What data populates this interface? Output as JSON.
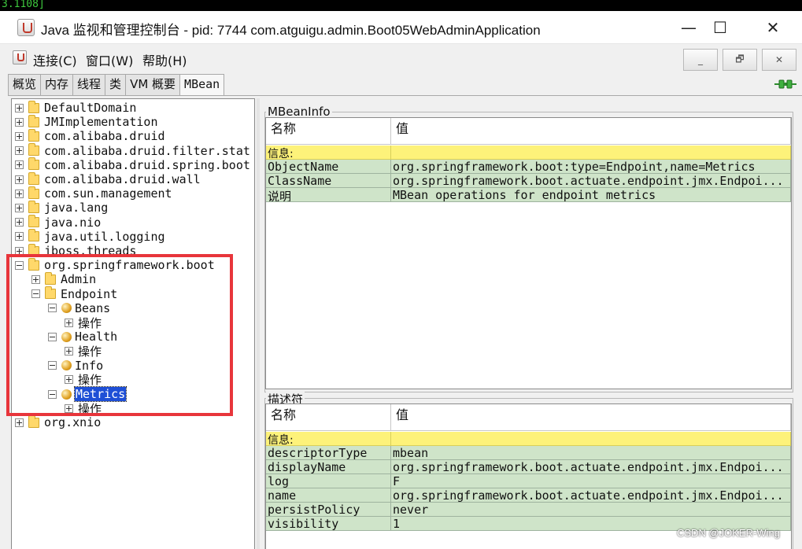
{
  "background_terminal": {
    "text": "3.1108]"
  },
  "window": {
    "title": "Java 监视和管理控制台 - pid: 7744 com.atguigu.admin.Boot05WebAdminApplication",
    "minimize_glyph": "—",
    "maximize_glyph": "☐",
    "close_glyph": "✕"
  },
  "menu": {
    "items": [
      "连接(C)",
      "窗口(W)",
      "帮助(H)"
    ],
    "mdi_minimize": "_",
    "mdi_restore": "🗗",
    "mdi_close": "✕"
  },
  "tabs": [
    "概览",
    "内存",
    "线程",
    "类",
    "VM 概要",
    "MBean"
  ],
  "active_tab": "MBean",
  "tree": [
    {
      "label": "DefaultDomain",
      "toggle": "plus",
      "icon": "folder"
    },
    {
      "label": "JMImplementation",
      "toggle": "plus",
      "icon": "folder"
    },
    {
      "label": "com.alibaba.druid",
      "toggle": "plus",
      "icon": "folder"
    },
    {
      "label": "com.alibaba.druid.filter.stat",
      "toggle": "plus",
      "icon": "folder"
    },
    {
      "label": "com.alibaba.druid.spring.boot",
      "toggle": "plus",
      "icon": "folder"
    },
    {
      "label": "com.alibaba.druid.wall",
      "toggle": "plus",
      "icon": "folder"
    },
    {
      "label": "com.sun.management",
      "toggle": "plus",
      "icon": "folder"
    },
    {
      "label": "java.lang",
      "toggle": "plus",
      "icon": "folder"
    },
    {
      "label": "java.nio",
      "toggle": "plus",
      "icon": "folder"
    },
    {
      "label": "java.util.logging",
      "toggle": "plus",
      "icon": "folder"
    },
    {
      "label": "jboss.threads",
      "toggle": "plus",
      "icon": "folder"
    },
    {
      "label": "org.springframework.boot",
      "toggle": "minus",
      "icon": "folder"
    },
    {
      "label": "Admin",
      "toggle": "plus",
      "icon": "folder"
    },
    {
      "label": "Endpoint",
      "toggle": "minus",
      "icon": "folder"
    },
    {
      "label": "Beans",
      "toggle": "minus",
      "icon": "bean"
    },
    {
      "label": "操作",
      "toggle": "plus",
      "icon": "none"
    },
    {
      "label": "Health",
      "toggle": "minus",
      "icon": "bean"
    },
    {
      "label": "操作",
      "toggle": "plus",
      "icon": "none"
    },
    {
      "label": "Info",
      "toggle": "minus",
      "icon": "bean"
    },
    {
      "label": "操作",
      "toggle": "plus",
      "icon": "none"
    },
    {
      "label": "Metrics",
      "toggle": "minus",
      "icon": "bean",
      "selected": true
    },
    {
      "label": "操作",
      "toggle": "plus",
      "icon": "none"
    },
    {
      "label": "org.xnio",
      "toggle": "plus",
      "icon": "folder"
    }
  ],
  "highlight_color": "#e8353b",
  "mbean_info": {
    "title": "MBeanInfo",
    "col_name": "名称",
    "col_value": "值",
    "section": "信息:",
    "rows": [
      {
        "name": "ObjectName",
        "value": "org.springframework.boot:type=Endpoint,name=Metrics"
      },
      {
        "name": "ClassName",
        "value": "org.springframework.boot.actuate.endpoint.jmx.Endpoi..."
      },
      {
        "name": "说明",
        "value": "MBean operations for endpoint metrics"
      }
    ]
  },
  "descriptor": {
    "title": "描述符",
    "col_name": "名称",
    "col_value": "值",
    "section": "信息:",
    "rows": [
      {
        "name": "descriptorType",
        "value": "mbean"
      },
      {
        "name": "displayName",
        "value": "org.springframework.boot.actuate.endpoint.jmx.Endpoi..."
      },
      {
        "name": "log",
        "value": "F"
      },
      {
        "name": "name",
        "value": "org.springframework.boot.actuate.endpoint.jmx.Endpoi..."
      },
      {
        "name": "persistPolicy",
        "value": "never"
      },
      {
        "name": "visibility",
        "value": "1"
      }
    ]
  },
  "watermark": "CSDN @JOKER-Wing"
}
